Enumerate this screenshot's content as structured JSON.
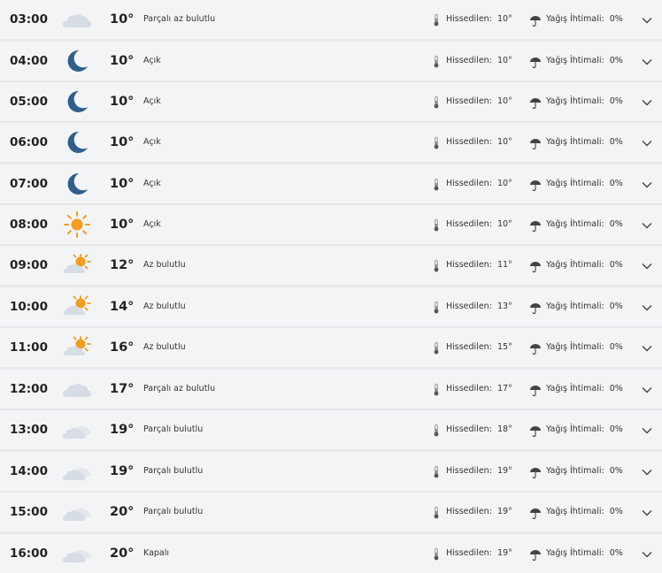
{
  "hourly_forecast": {
    "feels_like_label": "Hissedilen:",
    "rain_chance_label": "Yağış İhtimali:",
    "rows": [
      {
        "time": "03:00",
        "icon": "cloud-icon",
        "temp": "10°",
        "condition": "Parçalı az bulutlu",
        "feels_like": "10°",
        "rain_chance": "0%"
      },
      {
        "time": "04:00",
        "icon": "moon-icon",
        "temp": "10°",
        "condition": "Açık",
        "feels_like": "10°",
        "rain_chance": "0%"
      },
      {
        "time": "05:00",
        "icon": "moon-icon",
        "temp": "10°",
        "condition": "Açık",
        "feels_like": "10°",
        "rain_chance": "0%"
      },
      {
        "time": "06:00",
        "icon": "moon-icon",
        "temp": "10°",
        "condition": "Açık",
        "feels_like": "10°",
        "rain_chance": "0%"
      },
      {
        "time": "07:00",
        "icon": "moon-icon",
        "temp": "10°",
        "condition": "Açık",
        "feels_like": "10°",
        "rain_chance": "0%"
      },
      {
        "time": "08:00",
        "icon": "sun-icon",
        "temp": "10°",
        "condition": "Açık",
        "feels_like": "10°",
        "rain_chance": "0%"
      },
      {
        "time": "09:00",
        "icon": "sun-cloud-icon",
        "temp": "12°",
        "condition": "Az bulutlu",
        "feels_like": "11°",
        "rain_chance": "0%"
      },
      {
        "time": "10:00",
        "icon": "sun-cloud-icon",
        "temp": "14°",
        "condition": "Az bulutlu",
        "feels_like": "13°",
        "rain_chance": "0%"
      },
      {
        "time": "11:00",
        "icon": "sun-cloud-icon",
        "temp": "16°",
        "condition": "Az bulutlu",
        "feels_like": "15°",
        "rain_chance": "0%"
      },
      {
        "time": "12:00",
        "icon": "cloud-icon",
        "temp": "17°",
        "condition": "Parçalı az bulutlu",
        "feels_like": "17°",
        "rain_chance": "0%"
      },
      {
        "time": "13:00",
        "icon": "clouds-icon",
        "temp": "19°",
        "condition": "Parçalı bulutlu",
        "feels_like": "18°",
        "rain_chance": "0%"
      },
      {
        "time": "14:00",
        "icon": "clouds-icon",
        "temp": "19°",
        "condition": "Parçalı bulutlu",
        "feels_like": "19°",
        "rain_chance": "0%"
      },
      {
        "time": "15:00",
        "icon": "clouds-icon",
        "temp": "20°",
        "condition": "Parçalı bulutlu",
        "feels_like": "19°",
        "rain_chance": "0%"
      },
      {
        "time": "16:00",
        "icon": "clouds-icon",
        "temp": "20°",
        "condition": "Kapalı",
        "feels_like": "19°",
        "rain_chance": "0%"
      }
    ]
  },
  "colors": {
    "moon": "#2f5f8a",
    "sun": "#f39c1f",
    "cloud": "#d7dde4",
    "row_background": "#f3f4f6",
    "divider": "#e6e8ec"
  }
}
